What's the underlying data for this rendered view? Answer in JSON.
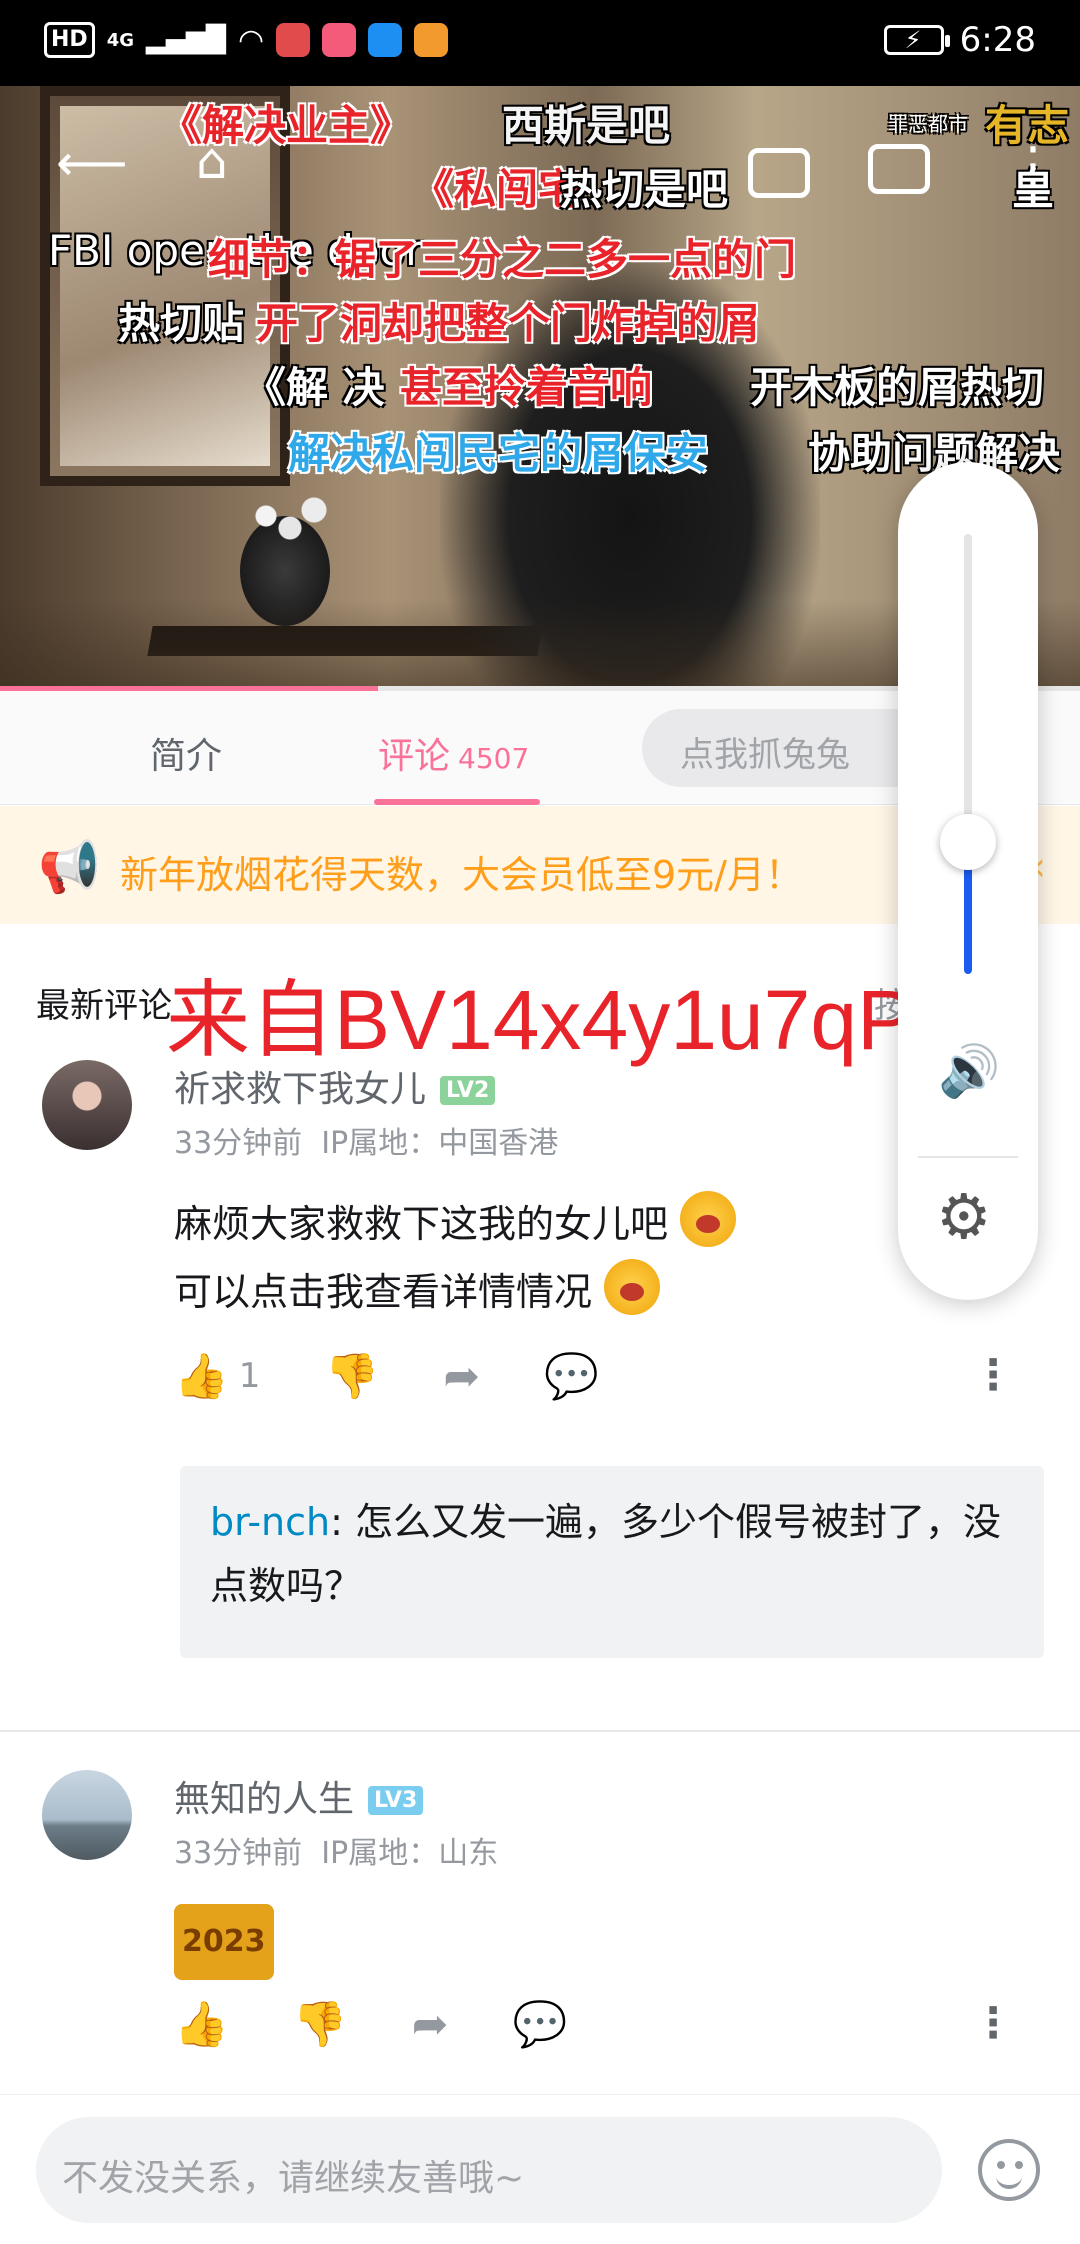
{
  "status_bar": {
    "hd": "HD",
    "network": "4G",
    "time": "6:28"
  },
  "video": {
    "danmaku": [
      "《解决业主》",
      "西斯是吧",
      "有志",
      "罪恶都市",
      "《私闯宅",
      "热切是吧",
      "皇",
      "FBI open the door",
      "细节：锯了三分之二多一点的门",
      "热切贴",
      "开了洞却把整个门炸掉的屑",
      "《解  决",
      "甚至拎着音响",
      "开木板的屑热切",
      "解决私闯民宅的屑保安",
      "协助问题解决"
    ],
    "progress": 0.35,
    "icons": [
      "back-arrow-icon",
      "home-icon",
      "pip-icon",
      "tv-cast-icon",
      "more-vertical-icon"
    ]
  },
  "tabs": {
    "intro": "简介",
    "comments": "评论",
    "comments_count": "4507",
    "danmaku_placeholder": "点我抓兔兔"
  },
  "notice": {
    "text": "新年放烟花得天数，大会员低至9元/月！"
  },
  "comments_section": {
    "title": "最新评论",
    "sort_hint": "按时间",
    "watermark": "来自BV14x4y1u7qP"
  },
  "comments": [
    {
      "user": "祈求救下我女儿",
      "level": "LV2",
      "time": "33分钟前",
      "ip": "IP属地：中国香港",
      "lines": [
        "麻烦大家救救下这我的女儿吧",
        "可以点击我查看详情情况"
      ],
      "likes": "1",
      "reply": {
        "user": "br-nch",
        "text": ": 怎么又发一遍，多少个假号被封了，没点数吗？"
      }
    },
    {
      "user": "無知的人生",
      "level": "LV3",
      "time": "33分钟前",
      "ip": "IP属地：山东",
      "sticker": "2023"
    }
  ],
  "bottom": {
    "placeholder": "不发没关系，请继续友善哦~"
  },
  "volume": {
    "level": 0.3
  },
  "colors": {
    "accent": "#fb7299",
    "notice": "#ff9e1b",
    "volume": "#1a5cf2",
    "reply_user": "#008ac5"
  }
}
